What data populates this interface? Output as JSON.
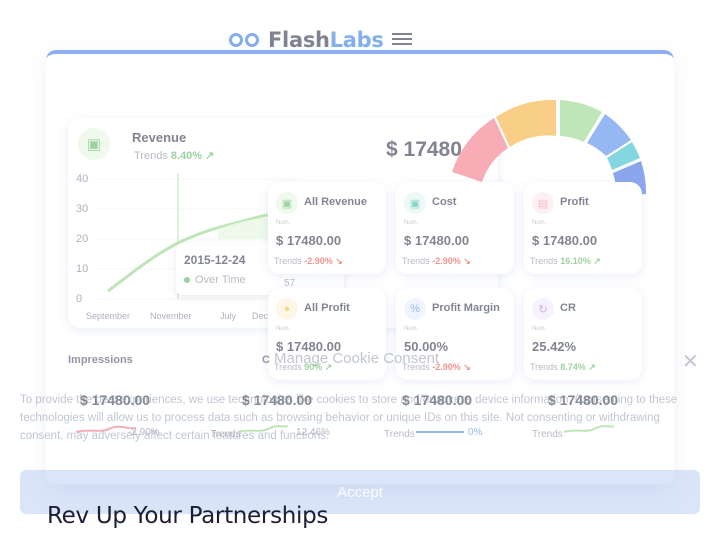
{
  "header": {
    "logo_part1": "Flash",
    "logo_part2": "Labs",
    "brand_color": "#1f6fe0"
  },
  "revenue_card": {
    "title": "Revenue",
    "trend_label": "Trends",
    "trend_value": "8.40%",
    "amount": "$ 17480",
    "y_ticks": [
      "40",
      "30",
      "20",
      "10",
      "0"
    ],
    "x_ticks": [
      "September",
      "November",
      "July",
      "Dec"
    ],
    "tooltip_date": "2015-12-24",
    "tooltip_label": "Over Time"
  },
  "metric_cards": [
    {
      "title": "All Revenue",
      "num_label": "Num.",
      "value": "$ 17480.00",
      "trend_label": "Trends",
      "trend": "-2.90%",
      "direction": "down",
      "icon": "wallet-icon",
      "icon_color": "#4caf50"
    },
    {
      "title": "Cost",
      "num_label": "Num.",
      "value": "$ 17480.00",
      "trend_label": "Trends",
      "trend": "-2.90%",
      "direction": "down",
      "icon": "wallet-icon",
      "icon_color": "#26b5a0"
    },
    {
      "title": "Profit",
      "num_label": "Num.",
      "value": "$ 17480.00",
      "trend_label": "Trends",
      "trend": "16.10%",
      "direction": "up",
      "icon": "money-icon",
      "icon_color": "#f0829a"
    },
    {
      "title": "All Profit",
      "num_label": "Num.",
      "value": "$ 17480.00",
      "trend_label": "Trends",
      "trend": "90%",
      "direction": "up",
      "icon": "coin-icon",
      "icon_color": "#f2b632"
    },
    {
      "title": "Profit Margin",
      "num_label": "Num.",
      "value": "50.00%",
      "trend_label": "Trends",
      "trend": "-2.90%",
      "direction": "down",
      "icon": "percent-icon",
      "icon_color": "#3f7fe8"
    },
    {
      "title": "CR",
      "num_label": "Num.",
      "value": "25.42%",
      "trend_label": "Trends",
      "trend": "8.74%",
      "direction": "up",
      "icon": "refresh-icon",
      "icon_color": "#9c6ce8"
    }
  ],
  "bottom_stats": {
    "impressions_label": "Impressions",
    "items": [
      {
        "value": "$ 17480.00",
        "trend_label": "Trends",
        "trend": "-2.90%"
      },
      {
        "value": "$ 17480.00",
        "trend_label": "Trends",
        "trend": "12.46%"
      },
      {
        "value": "$ 17480.00",
        "trend_label": "Trends",
        "trend": "0%"
      },
      {
        "value": "$ 17480.00",
        "trend_label": "Trends",
        "trend": ""
      }
    ],
    "partial_label": "C",
    "partial_number": "57"
  },
  "cookie": {
    "title": "Manage Cookie Consent",
    "text": "To provide the best experiences, we use technologies like cookies to store and/or access device information. Consenting to these technologies will allow us to process data such as browsing behavior or unique IDs on this site. Not consenting or withdrawing consent, may adversely affect certain features and functions.",
    "accept_label": "Accept",
    "close_symbol": "✕"
  },
  "headline": "Rev Up Your Partnerships"
}
